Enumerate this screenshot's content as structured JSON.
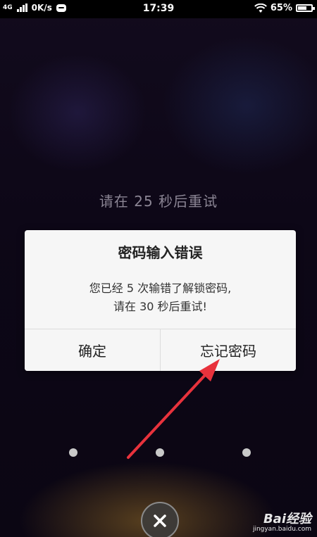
{
  "status_bar": {
    "network": "4G",
    "speed": "0K/s",
    "time": "17:39",
    "battery": "65%",
    "battery_level": 0.65
  },
  "lock_screen": {
    "retry_hint": "请在 25 秒后重试"
  },
  "dialog": {
    "title": "密码输入错误",
    "message_line1": "您已经 5 次输错了解锁密码,",
    "message_line2": "请在 30 秒后重试!",
    "confirm_label": "确定",
    "forgot_label": "忘记密码"
  },
  "watermark": {
    "brand": "Bai经验",
    "url": "jingyan.baidu.com"
  },
  "colors": {
    "annotation_arrow": "#e8323c",
    "dialog_background": "#f6f6f6"
  },
  "icons": {
    "close": "close-icon",
    "wifi": "wifi-icon",
    "battery": "battery-icon",
    "signal": "signal-icon"
  }
}
